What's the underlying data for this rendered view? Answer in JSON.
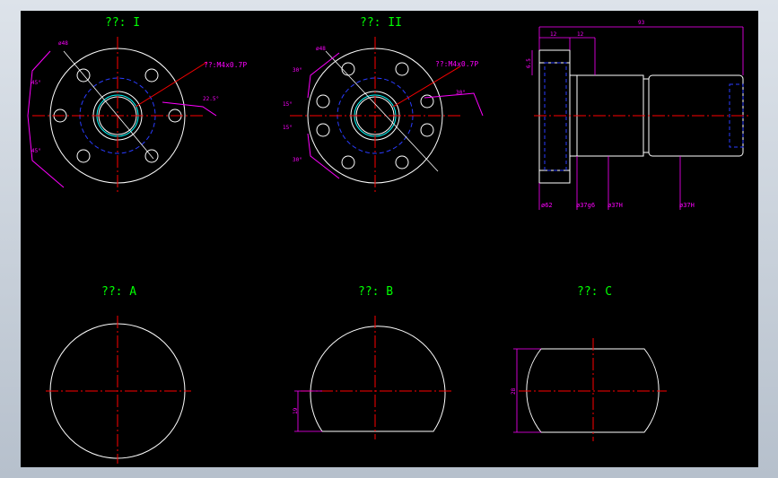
{
  "colors": {
    "background": "#000000",
    "outline": "#ffffff",
    "centerline": "#ff0000",
    "hidden": "#2a3cff",
    "dimension": "#ff00ff",
    "text": "#00ff00",
    "pitch_circle": "#2a3cff",
    "bore": "#00ffff"
  },
  "views": {
    "view1": {
      "title": "??: I",
      "dia": "ø48",
      "thread": "??:M4x0.7P",
      "ang1": "45°",
      "ang2": "45°",
      "ang3": "22.5°"
    },
    "view2": {
      "title": "??: II",
      "dia": "ø48",
      "thread": "??:M4x0.7P",
      "ang1": "30°",
      "ang2": "15°",
      "ang3": "15°",
      "ang4": "30°",
      "ang5": "30°"
    },
    "side": {
      "dim_top": "93",
      "dim_12a": "12",
      "dim_12b": "12",
      "dim_left": "6.5",
      "d1": "ø62",
      "d2": "ø37g6",
      "d3": "ø37H",
      "d4": "ø37H"
    },
    "viewA": {
      "title": "??: A"
    },
    "viewB": {
      "title": "??: B",
      "dim": "19"
    },
    "viewC": {
      "title": "??: C",
      "dim": "28"
    }
  }
}
